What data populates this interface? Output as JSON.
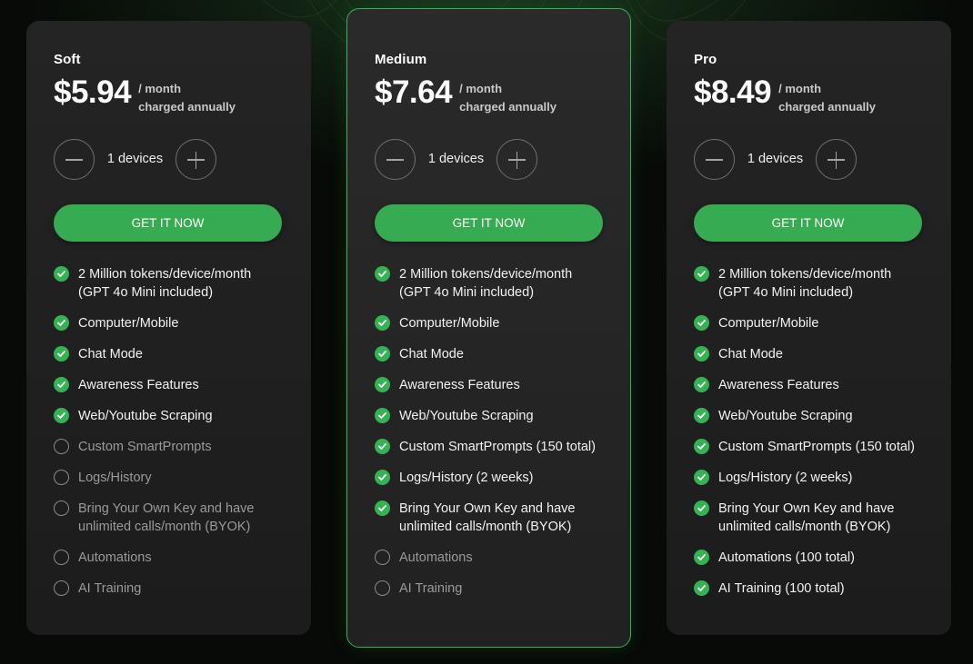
{
  "device_label_suffix": "devices",
  "plans": [
    {
      "name": "Soft",
      "price": "$5.94",
      "period": "/ month",
      "billing": "charged annually",
      "devices": "1 devices",
      "cta": "GET IT NOW",
      "features": [
        {
          "text": "2 Million tokens/device/month (GPT 4o Mini included)",
          "included": true
        },
        {
          "text": "Computer/Mobile",
          "included": true
        },
        {
          "text": "Chat Mode",
          "included": true
        },
        {
          "text": "Awareness Features",
          "included": true
        },
        {
          "text": "Web/Youtube Scraping",
          "included": true
        },
        {
          "text": "Custom SmartPrompts",
          "included": false
        },
        {
          "text": "Logs/History",
          "included": false
        },
        {
          "text": "Bring Your Own Key and have unlimited calls/month (BYOK)",
          "included": false
        },
        {
          "text": "Automations",
          "included": false
        },
        {
          "text": "AI Training",
          "included": false
        }
      ]
    },
    {
      "name": "Medium",
      "price": "$7.64",
      "period": "/ month",
      "billing": "charged annually",
      "devices": "1 devices",
      "cta": "GET IT NOW",
      "highlighted": true,
      "features": [
        {
          "text": "2 Million tokens/device/month (GPT 4o Mini included)",
          "included": true
        },
        {
          "text": "Computer/Mobile",
          "included": true
        },
        {
          "text": "Chat Mode",
          "included": true
        },
        {
          "text": "Awareness Features",
          "included": true
        },
        {
          "text": "Web/Youtube Scraping",
          "included": true
        },
        {
          "text": "Custom SmartPrompts (150 total)",
          "included": true
        },
        {
          "text": "Logs/History (2 weeks)",
          "included": true
        },
        {
          "text": "Bring Your Own Key and have unlimited calls/month (BYOK)",
          "included": true
        },
        {
          "text": "Automations",
          "included": false
        },
        {
          "text": "AI Training",
          "included": false
        }
      ]
    },
    {
      "name": "Pro",
      "price": "$8.49",
      "period": "/ month",
      "billing": "charged annually",
      "devices": "1 devices",
      "cta": "GET IT NOW",
      "features": [
        {
          "text": "2 Million tokens/device/month (GPT 4o Mini included)",
          "included": true
        },
        {
          "text": "Computer/Mobile",
          "included": true
        },
        {
          "text": "Chat Mode",
          "included": true
        },
        {
          "text": "Awareness Features",
          "included": true
        },
        {
          "text": "Web/Youtube Scraping",
          "included": true
        },
        {
          "text": "Custom SmartPrompts (150 total)",
          "included": true
        },
        {
          "text": "Logs/History (2 weeks)",
          "included": true
        },
        {
          "text": "Bring Your Own Key and have unlimited calls/month (BYOK)",
          "included": true
        },
        {
          "text": "Automations (100 total)",
          "included": true
        },
        {
          "text": "AI Training (100 total)",
          "included": true
        }
      ]
    }
  ],
  "colors": {
    "accent": "#34b254",
    "card_bg": "#222222",
    "page_bg": "#060806"
  }
}
